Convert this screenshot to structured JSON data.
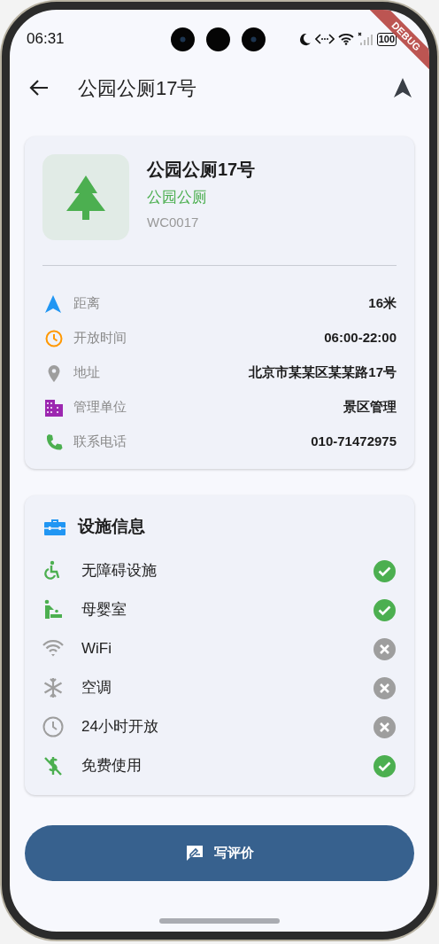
{
  "status_bar": {
    "time": "06:31",
    "battery": "100"
  },
  "debug_banner": "DEBUG",
  "app_bar": {
    "title": "公园公厕17号"
  },
  "place": {
    "name": "公园公厕17号",
    "category": "公园公厕",
    "code": "WC0017"
  },
  "info": [
    {
      "kind": "distance",
      "label": "距离",
      "value": "16米"
    },
    {
      "kind": "hours",
      "label": "开放时间",
      "value": "06:00-22:00"
    },
    {
      "kind": "address",
      "label": "地址",
      "value": "北京市某某区某某路17号"
    },
    {
      "kind": "manager",
      "label": "管理单位",
      "value": "景区管理"
    },
    {
      "kind": "phone",
      "label": "联系电话",
      "value": "010-71472975"
    }
  ],
  "facilities": {
    "title": "设施信息",
    "items": [
      {
        "kind": "accessible",
        "label": "无障碍设施",
        "available": true
      },
      {
        "kind": "baby",
        "label": "母婴室",
        "available": true
      },
      {
        "kind": "wifi",
        "label": "WiFi",
        "available": false
      },
      {
        "kind": "ac",
        "label": "空调",
        "available": false
      },
      {
        "kind": "allday",
        "label": "24小时开放",
        "available": false
      },
      {
        "kind": "free",
        "label": "免费使用",
        "available": true
      }
    ]
  },
  "review_button": "写评价"
}
